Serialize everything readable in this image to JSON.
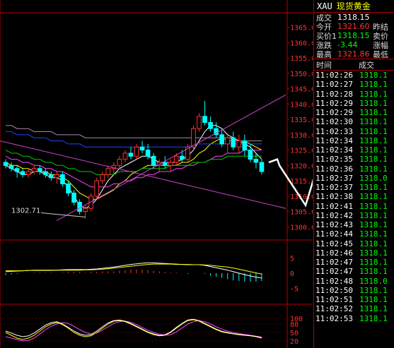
{
  "quote": {
    "symbol": "XAU",
    "name": "现货黄金",
    "rows": [
      {
        "label": "成交",
        "value": "1318.15",
        "cls": "white",
        "label2": ""
      },
      {
        "label": "今开",
        "value": "1321.60",
        "cls": "red",
        "label2": "昨结"
      },
      {
        "label": "买价1",
        "value": "1318.15",
        "cls": "green",
        "label2": "卖价"
      },
      {
        "label": "涨跌",
        "value": "-3.44",
        "cls": "green",
        "label2": "涨幅"
      },
      {
        "label": "最高",
        "value": "1321.86",
        "cls": "red",
        "label2": "最低"
      }
    ]
  },
  "ticks_header": {
    "time": "时间",
    "price": "成交"
  },
  "ticks": [
    {
      "time": "11:02:26",
      "price": "1318.1"
    },
    {
      "time": "11:02:27",
      "price": "1318.1"
    },
    {
      "time": "11:02:28",
      "price": "1318.1"
    },
    {
      "time": "11:02:29",
      "price": "1318.1"
    },
    {
      "time": "11:02:29",
      "price": "1318.1"
    },
    {
      "time": "11:02:30",
      "price": "1318.1"
    },
    {
      "time": "11:02:33",
      "price": "1318.1"
    },
    {
      "time": "11:02:34",
      "price": "1318.1"
    },
    {
      "time": "11:02:34",
      "price": "1318.1"
    },
    {
      "time": "11:02:35",
      "price": "1318.1"
    },
    {
      "time": "11:02:36",
      "price": "1318.1"
    },
    {
      "time": "11:02:37",
      "price": "1318.0"
    },
    {
      "time": "11:02:37",
      "price": "1318.1"
    },
    {
      "time": "11:02:38",
      "price": "1318.1"
    },
    {
      "time": "11:02:41",
      "price": "1318.1"
    },
    {
      "time": "11:02:42",
      "price": "1318.1"
    },
    {
      "time": "11:02:43",
      "price": "1318.1"
    },
    {
      "time": "11:02:44",
      "price": "1318.1"
    },
    {
      "time": "11:02:45",
      "price": "1318.1"
    },
    {
      "time": "11:02:46",
      "price": "1318.1"
    },
    {
      "time": "11:02:47",
      "price": "1318.1"
    },
    {
      "time": "11:02:47",
      "price": "1318.1"
    },
    {
      "time": "11:02:48",
      "price": "1318.0"
    },
    {
      "time": "11:02:50",
      "price": "1318.1"
    },
    {
      "time": "11:02:51",
      "price": "1318.1"
    },
    {
      "time": "11:02:52",
      "price": "1318.1"
    },
    {
      "time": "11:02:53",
      "price": "1318.1"
    }
  ],
  "chart_data": [
    {
      "type": "candlestick",
      "title": "",
      "y_ticks": [
        1300.0,
        1305.0,
        1310.0,
        1315.0,
        1320.0,
        1325.0,
        1330.0,
        1335.0,
        1340.0,
        1345.0,
        1350.0,
        1355.0,
        1360.0,
        1365.0
      ],
      "ylim": [
        1298,
        1367
      ],
      "annotation": "1302.71",
      "candles": [
        [
          1321,
          1322,
          1319,
          1320
        ],
        [
          1320,
          1321,
          1318,
          1319
        ],
        [
          1319,
          1320,
          1316,
          1318
        ],
        [
          1318,
          1319,
          1316,
          1317
        ],
        [
          1317,
          1319,
          1316,
          1318
        ],
        [
          1318,
          1320,
          1317,
          1319
        ],
        [
          1319,
          1320,
          1317,
          1318
        ],
        [
          1318,
          1319,
          1316,
          1317
        ],
        [
          1317,
          1318,
          1315,
          1316
        ],
        [
          1316,
          1318,
          1314,
          1317
        ],
        [
          1317,
          1318,
          1313,
          1314
        ],
        [
          1314,
          1315,
          1310,
          1311
        ],
        [
          1311,
          1312,
          1307,
          1308
        ],
        [
          1308,
          1309,
          1304,
          1305
        ],
        [
          1305,
          1307,
          1302.71,
          1306
        ],
        [
          1306,
          1311,
          1305,
          1310
        ],
        [
          1310,
          1316,
          1309,
          1315
        ],
        [
          1315,
          1318,
          1314,
          1317
        ],
        [
          1317,
          1320,
          1316,
          1319
        ],
        [
          1319,
          1321,
          1317,
          1320
        ],
        [
          1320,
          1323,
          1319,
          1322
        ],
        [
          1322,
          1325,
          1321,
          1324
        ],
        [
          1324,
          1326,
          1322,
          1323
        ],
        [
          1323,
          1327,
          1322,
          1326
        ],
        [
          1326,
          1328,
          1324,
          1325
        ],
        [
          1325,
          1327,
          1322,
          1323
        ],
        [
          1323,
          1324,
          1319,
          1320
        ],
        [
          1320,
          1322,
          1318,
          1321
        ],
        [
          1321,
          1323,
          1319,
          1320
        ],
        [
          1320,
          1322,
          1318,
          1321
        ],
        [
          1321,
          1324,
          1320,
          1323
        ],
        [
          1323,
          1325,
          1321,
          1322
        ],
        [
          1322,
          1327,
          1321,
          1326
        ],
        [
          1326,
          1333,
          1325,
          1332
        ],
        [
          1332,
          1337,
          1331,
          1336
        ],
        [
          1336,
          1341,
          1333,
          1334
        ],
        [
          1334,
          1336,
          1331,
          1332
        ],
        [
          1332,
          1334,
          1329,
          1330
        ],
        [
          1330,
          1332,
          1326,
          1327
        ],
        [
          1327,
          1330,
          1324,
          1329
        ],
        [
          1329,
          1331,
          1325,
          1326
        ],
        [
          1326,
          1330,
          1324,
          1328
        ],
        [
          1328,
          1330,
          1323,
          1325
        ],
        [
          1325,
          1327,
          1321,
          1322
        ],
        [
          1322,
          1324,
          1319,
          1321
        ],
        [
          1321,
          1322,
          1317,
          1318
        ]
      ],
      "series": [
        {
          "name": "",
          "color": "#ffffff",
          "values": [
            1320,
            1319,
            1318,
            1317,
            1317,
            1318,
            1318,
            1317,
            1316,
            1316,
            1315,
            1313,
            1310,
            1307,
            1306,
            1307,
            1309,
            1312,
            1315,
            1317,
            1319,
            1320,
            1321,
            1322,
            1323,
            1323,
            1322,
            1321,
            1321,
            1321,
            1321,
            1322,
            1323,
            1325,
            1328,
            1331,
            1333,
            1333,
            1332,
            1330,
            1329,
            1328,
            1327,
            1326,
            1324,
            1322
          ]
        },
        {
          "name": "",
          "color": "#ffff00",
          "values": [
            1321,
            1320,
            1320,
            1319,
            1319,
            1318,
            1318,
            1318,
            1317,
            1317,
            1316,
            1315,
            1313,
            1311,
            1310,
            1309,
            1309,
            1310,
            1311,
            1312,
            1314,
            1315,
            1317,
            1318,
            1319,
            1320,
            1320,
            1320,
            1320,
            1320,
            1320,
            1321,
            1321,
            1322,
            1324,
            1325,
            1327,
            1328,
            1329,
            1329,
            1329,
            1328,
            1328,
            1327,
            1326,
            1325
          ]
        },
        {
          "name": "",
          "color": "#ff44ff",
          "values": [
            1323,
            1322,
            1322,
            1321,
            1321,
            1320,
            1320,
            1319,
            1319,
            1318,
            1318,
            1317,
            1316,
            1315,
            1314,
            1313,
            1313,
            1313,
            1313,
            1314,
            1314,
            1315,
            1315,
            1316,
            1316,
            1317,
            1317,
            1318,
            1318,
            1318,
            1319,
            1319,
            1320,
            1320,
            1321,
            1321,
            1322,
            1323,
            1323,
            1324,
            1324,
            1324,
            1325,
            1325,
            1325,
            1325
          ]
        },
        {
          "name": "",
          "color": "#00cc00",
          "values": [
            1325,
            1324,
            1324,
            1323,
            1323,
            1322,
            1322,
            1321,
            1321,
            1320,
            1320,
            1319,
            1319,
            1318,
            1318,
            1318,
            1317,
            1317,
            1317,
            1317,
            1318,
            1318,
            1318,
            1318,
            1319,
            1319,
            1319,
            1319,
            1319,
            1320,
            1320,
            1320,
            1320,
            1321,
            1321,
            1321,
            1322,
            1322,
            1322,
            1323,
            1323,
            1323,
            1323,
            1323,
            1323,
            1323
          ]
        },
        {
          "name": "",
          "color": "#2244ff",
          "values": [
            1331,
            1331,
            1330,
            1330,
            1330,
            1329,
            1329,
            1329,
            1328,
            1328,
            1328,
            1327,
            1327,
            1327,
            1326,
            1326,
            1326,
            1326,
            1326,
            1326,
            1326,
            1326,
            1326,
            1326,
            1326,
            1326,
            1326,
            1326,
            1326,
            1326,
            1326,
            1326,
            1326,
            1327,
            1327,
            1327,
            1327,
            1327,
            1327,
            1327,
            1327,
            1327,
            1327,
            1327,
            1327,
            1327
          ]
        },
        {
          "name": "",
          "color": "#aa88aa",
          "values": [
            1333,
            1333,
            1332,
            1332,
            1332,
            1331,
            1331,
            1331,
            1331,
            1330,
            1330,
            1330,
            1330,
            1330,
            1329,
            1329,
            1329,
            1329,
            1329,
            1329,
            1329,
            1329,
            1329,
            1329,
            1329,
            1329,
            1329,
            1329,
            1329,
            1329,
            1329,
            1329,
            1329,
            1329,
            1329,
            1329,
            1329,
            1329,
            1329,
            1328,
            1328,
            1328,
            1328,
            1328,
            1328,
            1328
          ]
        }
      ]
    },
    {
      "type": "bar",
      "title": "",
      "y_ticks": [
        -5,
        0,
        5
      ],
      "ylim": [
        -7,
        7
      ],
      "values": [
        0,
        0,
        0,
        0,
        0,
        0,
        0,
        0,
        0,
        0,
        0,
        0,
        0,
        0,
        0,
        0,
        0,
        0,
        0,
        0,
        0,
        0,
        0,
        0,
        0,
        0,
        0,
        0,
        0,
        0,
        0,
        0,
        0,
        0,
        0,
        0,
        0,
        0,
        0,
        0,
        0,
        0,
        0,
        0,
        0,
        0
      ],
      "series": [
        {
          "name": "",
          "color": "#ffffff",
          "values": [
            0.5,
            0.6,
            0.7,
            0.8,
            0.9,
            1.0,
            1.0,
            1.0,
            1.0,
            1.0,
            1.1,
            1.2,
            1.2,
            1.2,
            1.2,
            1.3,
            1.4,
            1.6,
            1.8,
            2.0,
            2.3,
            2.6,
            2.9,
            3.1,
            3.3,
            3.4,
            3.4,
            3.3,
            3.2,
            3.1,
            3.0,
            2.9,
            2.8,
            2.8,
            2.8,
            2.6,
            2.2,
            1.8,
            1.4,
            1.0,
            0.5,
            0.0,
            -0.5,
            -0.9,
            -1.3,
            -1.6
          ]
        },
        {
          "name": "",
          "color": "#ffff00",
          "values": [
            0.8,
            0.8,
            0.8,
            0.8,
            0.9,
            0.9,
            0.9,
            0.9,
            0.9,
            1.0,
            1.0,
            1.0,
            1.0,
            1.0,
            1.1,
            1.1,
            1.2,
            1.3,
            1.5,
            1.7,
            1.9,
            2.1,
            2.3,
            2.5,
            2.7,
            2.9,
            3.0,
            3.0,
            3.0,
            3.0,
            2.9,
            2.9,
            2.9,
            2.8,
            2.8,
            2.7,
            2.6,
            2.4,
            2.2,
            2.0,
            1.7,
            1.3,
            0.9,
            0.5,
            0.1,
            -0.3
          ]
        }
      ]
    },
    {
      "type": "line",
      "title": "",
      "y_ticks": [
        20,
        50,
        80,
        100
      ],
      "ylim": [
        0,
        110
      ],
      "series": [
        {
          "name": "",
          "color": "#ffff00",
          "values": [
            50,
            40,
            30,
            25,
            30,
            40,
            55,
            70,
            80,
            85,
            78,
            65,
            50,
            40,
            35,
            38,
            50,
            65,
            80,
            90,
            92,
            88,
            80,
            70,
            60,
            50,
            42,
            38,
            40,
            50,
            65,
            80,
            92,
            95,
            90,
            80,
            70,
            60,
            52,
            48,
            45,
            42,
            40,
            38,
            35,
            30
          ]
        },
        {
          "name": "",
          "color": "#ff44ff",
          "values": [
            35,
            30,
            25,
            20,
            22,
            30,
            45,
            60,
            72,
            80,
            85,
            82,
            72,
            60,
            50,
            45,
            48,
            58,
            70,
            82,
            88,
            90,
            86,
            78,
            68,
            58,
            50,
            44,
            40,
            42,
            52,
            66,
            80,
            88,
            92,
            88,
            80,
            70,
            62,
            55,
            50,
            46,
            43,
            40,
            37,
            34
          ]
        },
        {
          "name": "",
          "color": "#ffffff",
          "values": [
            55,
            48,
            40,
            35,
            38,
            48,
            62,
            76,
            85,
            88,
            80,
            68,
            55,
            45,
            40,
            42,
            55,
            70,
            84,
            92,
            94,
            90,
            82,
            72,
            62,
            52,
            45,
            40,
            42,
            52,
            68,
            82,
            94,
            97,
            92,
            82,
            72,
            62,
            54,
            50,
            46,
            43,
            41,
            39,
            36,
            31
          ]
        }
      ]
    }
  ]
}
